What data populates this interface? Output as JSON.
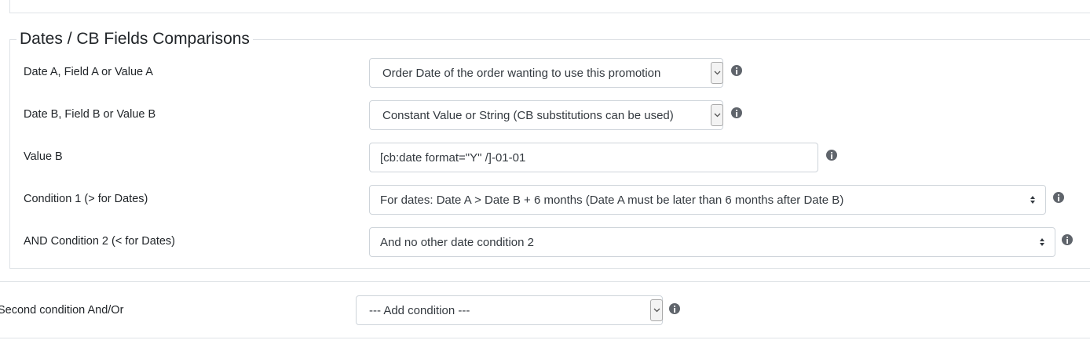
{
  "group": {
    "legend": "Dates / CB Fields Comparisons",
    "rows": [
      {
        "label": "Date A, Field A or Value A",
        "value": "Order Date of the order wanting to use this promotion"
      },
      {
        "label": "Date B, Field B or Value B",
        "value": "Constant Value or String (CB substitutions can be used)"
      },
      {
        "label": "Value B",
        "value": "[cb:date format=\"Y\" /]-01-01"
      },
      {
        "label": "Condition 1 (> for Dates)",
        "value": "For dates: Date A > Date B + 6 months (Date A must be later than 6 months after Date B)"
      },
      {
        "label": "AND Condition 2 (< for Dates)",
        "value": "And no other date condition 2"
      }
    ]
  },
  "second_condition": {
    "label": "Second condition And/Or",
    "value": "--- Add condition ---"
  },
  "icons": {
    "info": "info-circle-icon",
    "dropdown": "chevron-down-icon",
    "sort": "sort-arrows-icon"
  },
  "colors": {
    "border": "#ced4da",
    "panel_border": "#dee2e6",
    "text": "#212529",
    "icon": "#5f646b"
  }
}
